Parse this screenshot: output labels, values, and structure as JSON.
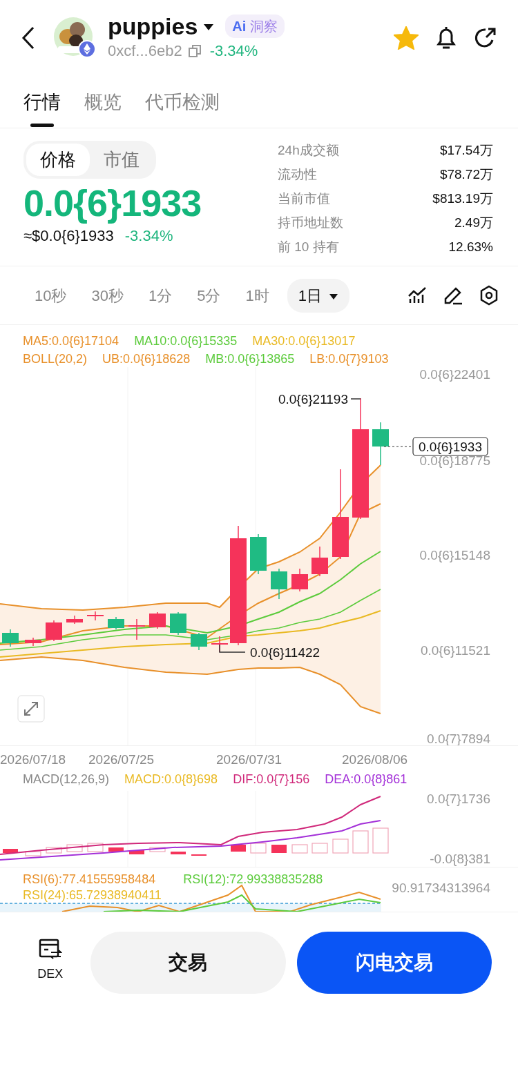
{
  "header": {
    "token_name": "puppies",
    "badge_mark": "Ai",
    "badge_text": "洞察",
    "address": "0xcf...6eb2",
    "change": "-3.34%",
    "favorited": true
  },
  "tabs": [
    {
      "label": "行情",
      "selected": true
    },
    {
      "label": "概览",
      "selected": false
    },
    {
      "label": "代币检测",
      "selected": false
    }
  ],
  "price_toggle": [
    {
      "label": "价格",
      "selected": true
    },
    {
      "label": "市值",
      "selected": false
    }
  ],
  "price": {
    "value": "0.0{6}1933",
    "usd": "≈$0.0{6}1933",
    "change": "-3.34%"
  },
  "stats": [
    {
      "label": "24h成交额",
      "value": "$17.54万"
    },
    {
      "label": "流动性",
      "value": "$78.72万"
    },
    {
      "label": "当前市值",
      "value": "$813.19万"
    },
    {
      "label": "持币地址数",
      "value": "2.49万"
    },
    {
      "label": "前 10 持有",
      "value": "12.63%"
    }
  ],
  "intervals": [
    {
      "label": "10秒",
      "selected": false
    },
    {
      "label": "30秒",
      "selected": false
    },
    {
      "label": "1分",
      "selected": false
    },
    {
      "label": "5分",
      "selected": false
    },
    {
      "label": "1时",
      "selected": false
    },
    {
      "label": "1日",
      "selected": true
    }
  ],
  "main_legend": [
    [
      {
        "text": "MA5:0.0{6}17104",
        "color": "#e8902a"
      },
      {
        "text": "MA10:0.0{6}15335",
        "color": "#5ccb3c"
      },
      {
        "text": "MA30:0.0{6}13017",
        "color": "#e9b922"
      }
    ],
    [
      {
        "text": "BOLL(20,2)",
        "color": "#e8902a"
      },
      {
        "text": "UB:0.0{6}18628",
        "color": "#e8902a"
      },
      {
        "text": "MB:0.0{6}13865",
        "color": "#5ccb3c"
      },
      {
        "text": "LB:0.0{7}9103",
        "color": "#e8902a"
      }
    ]
  ],
  "main_chart": {
    "y_labels": [
      "0.0{6}22401",
      "0.0{6}18775",
      "0.0{6}15148",
      "0.0{6}11521",
      "0.0{7}7894"
    ],
    "current_price": "0.0{6}1933",
    "high_label": "0.0{6}21193",
    "low_label": "0.0{6}11422"
  },
  "x_labels": [
    "2026/07/18",
    "2026/07/25",
    "2026/07/31",
    "2026/08/06"
  ],
  "macd": {
    "legend": [
      {
        "text": "MACD(12,26,9)",
        "color": "#888888"
      },
      {
        "text": "MACD:0.0{8}698",
        "color": "#e9b922"
      },
      {
        "text": "DIF:0.0{7}156",
        "color": "#d0287a"
      },
      {
        "text": "DEA:0.0{8}861",
        "color": "#a330d8"
      }
    ],
    "y_labels": [
      "0.0{7}1736",
      "-0.0{8}381"
    ]
  },
  "rsi": {
    "legend": [
      {
        "text": "RSI(6):77.41555958484",
        "color": "#e8902a"
      },
      {
        "text": "RSI(12):72.99338835288",
        "color": "#5ccb3c"
      },
      {
        "text": "RSI(24):65.72938940411",
        "color": "#e9b922"
      }
    ],
    "y_label": "90.91734313964"
  },
  "footer": {
    "dex_label": "DEX",
    "trade_button": "交易",
    "flash_button": "闪电交易"
  }
}
